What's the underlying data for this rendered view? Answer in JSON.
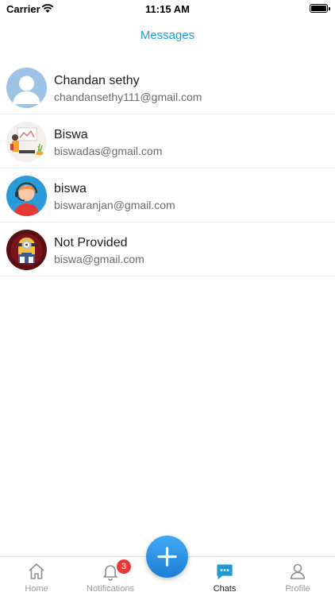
{
  "status_bar": {
    "carrier": "Carrier",
    "time": "11:15 AM"
  },
  "header": {
    "title": "Messages"
  },
  "contacts": [
    {
      "name": "Chandan sethy",
      "email": "chandansethy111@gmail.com",
      "avatar": "person-placeholder-icon"
    },
    {
      "name": "Biswa",
      "email": "biswadas@gmail.com",
      "avatar": "illustration-avatar"
    },
    {
      "name": "biswa",
      "email": "biswaranjan@gmail.com",
      "avatar": "headset-agent-avatar"
    },
    {
      "name": "Not Provided",
      "email": "biswa@gmail.com",
      "avatar": "minion-avatar"
    }
  ],
  "tab_bar": {
    "items": [
      {
        "label": "Home",
        "icon": "home-icon"
      },
      {
        "label": "Notifications",
        "icon": "bell-icon",
        "badge": "3"
      },
      {
        "label": "Chats",
        "icon": "chat-bubble-icon",
        "active": true
      },
      {
        "label": "Profile",
        "icon": "person-icon"
      }
    ],
    "fab_icon": "plus-icon"
  },
  "colors": {
    "accent": "#1f9ad6",
    "badge": "#e53935",
    "inactive": "#9a9a9a"
  }
}
